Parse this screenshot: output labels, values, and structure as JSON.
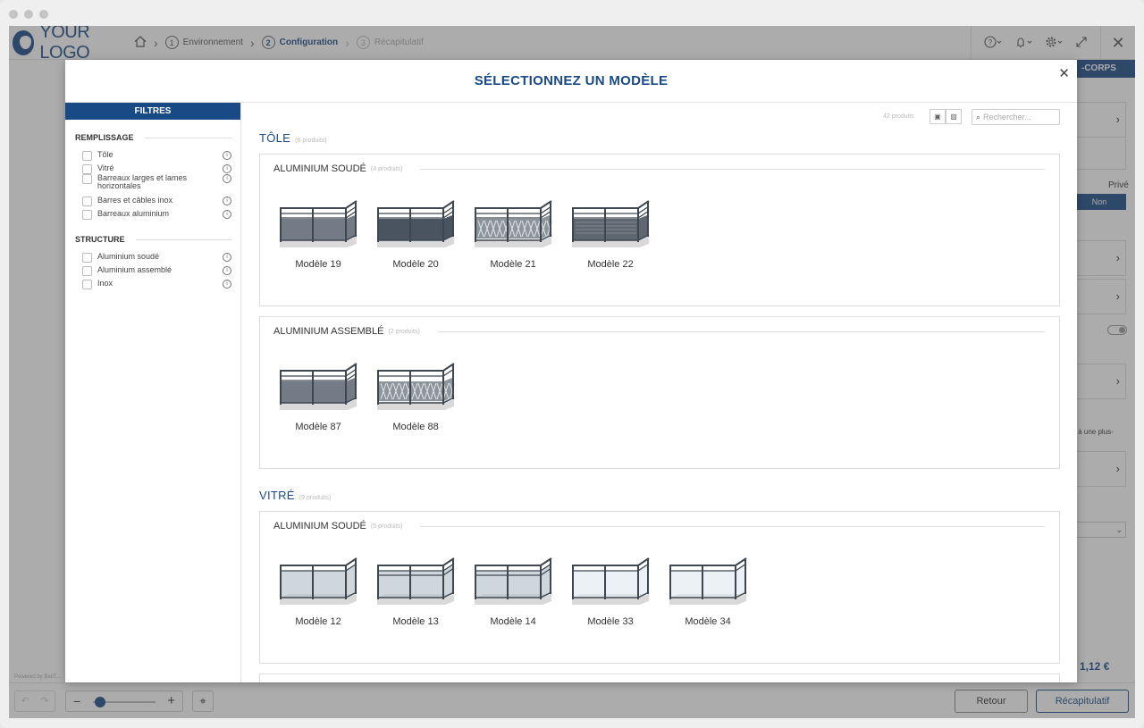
{
  "app": {
    "logo_text": "YOUR LOGO",
    "breadcrumb": [
      {
        "num": "1",
        "label": "Environnement"
      },
      {
        "num": "2",
        "label": "Configuration"
      },
      {
        "num": "3",
        "label": "Récapitulatif"
      }
    ],
    "powered": "Powered by BatiT..."
  },
  "right_panel": {
    "tab_label": "-CORPS",
    "prive_label": "Privé",
    "non_label": "Non",
    "note_text": "s à une plus-",
    "price": "1,12 €"
  },
  "bottom": {
    "retour_label": "Retour",
    "recap_label": "Récapitulatif"
  },
  "modal": {
    "title": "SÉLECTIONNEZ UN MODÈLE",
    "product_count": "42 produits",
    "search_placeholder": "Rechercher..."
  },
  "filters": {
    "header": "FILTRES",
    "sections": [
      {
        "title": "REMPLISSAGE",
        "items": [
          "Tôle",
          "Vitré",
          "Barreaux larges et lames horizontales",
          "Barres et câbles inox",
          "Barreaux aluminium"
        ]
      },
      {
        "title": "STRUCTURE",
        "items": [
          "Aluminium soudé",
          "Aluminium assemblé",
          "Inox"
        ]
      }
    ]
  },
  "catalog": [
    {
      "title": "TÔLE",
      "count": "(6 produits)",
      "groups": [
        {
          "title": "ALUMINIUM SOUDÉ",
          "count": "(4 produits)",
          "products": [
            {
              "name": "Modèle 19",
              "style": "sheet"
            },
            {
              "name": "Modèle 20",
              "style": "sheet-dark"
            },
            {
              "name": "Modèle 21",
              "style": "pattern"
            },
            {
              "name": "Modèle 22",
              "style": "perforated"
            }
          ]
        },
        {
          "title": "ALUMINIUM ASSEMBLÉ",
          "count": "(2 produits)",
          "products": [
            {
              "name": "Modèle 87",
              "style": "sheet-assembled"
            },
            {
              "name": "Modèle 88",
              "style": "pattern-assembled"
            }
          ]
        }
      ]
    },
    {
      "title": "VITRÉ",
      "count": "(9 produits)",
      "groups": [
        {
          "title": "ALUMINIUM SOUDÉ",
          "count": "(5 produits)",
          "products": [
            {
              "name": "Modèle 12",
              "style": "glass"
            },
            {
              "name": "Modèle 13",
              "style": "glass-bars"
            },
            {
              "name": "Modèle 14",
              "style": "glass-bars"
            },
            {
              "name": "Modèle 33",
              "style": "glass-clear"
            },
            {
              "name": "Modèle 34",
              "style": "glass-clear"
            }
          ]
        }
      ]
    }
  ],
  "colors": {
    "brand": "#1a4a86",
    "overlay": "rgba(70,70,70,0.45)"
  }
}
